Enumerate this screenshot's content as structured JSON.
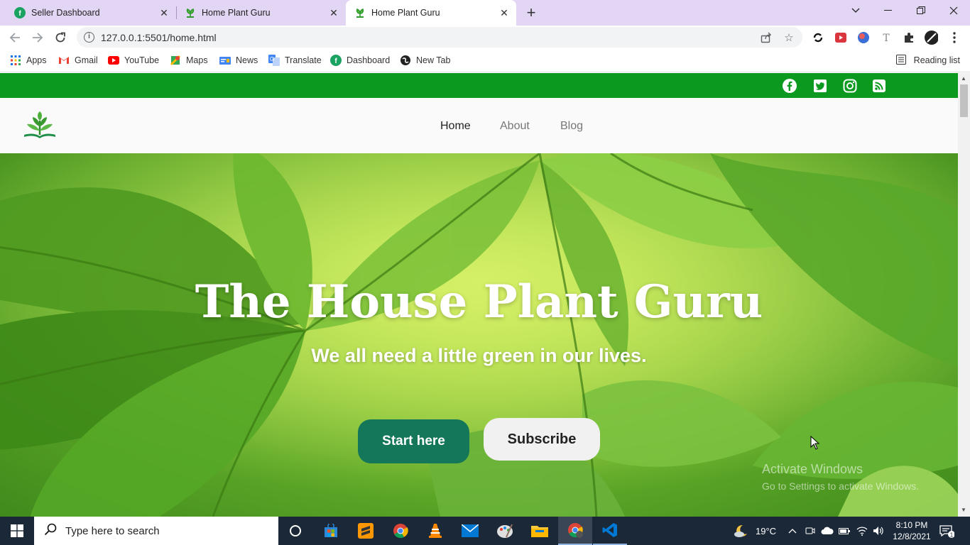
{
  "browser": {
    "tabs": [
      {
        "title": "Seller Dashboard",
        "icon": "dashboard-favicon"
      },
      {
        "title": "Home Plant Guru",
        "icon": "plant-favicon"
      },
      {
        "title": "Home Plant Guru",
        "icon": "plant-favicon",
        "active": true
      }
    ],
    "url": "127.0.0.1:5501/home.html",
    "bookmarks": [
      {
        "label": "Apps"
      },
      {
        "label": "Gmail"
      },
      {
        "label": "YouTube"
      },
      {
        "label": "Maps"
      },
      {
        "label": "News"
      },
      {
        "label": "Translate"
      },
      {
        "label": "Dashboard"
      },
      {
        "label": "New Tab"
      }
    ],
    "reading_list": "Reading list"
  },
  "site": {
    "social": [
      "facebook-icon",
      "twitter-icon",
      "instagram-icon",
      "rss-icon"
    ],
    "nav": [
      {
        "label": "Home",
        "current": true
      },
      {
        "label": "About"
      },
      {
        "label": "Blog"
      }
    ],
    "hero": {
      "title": "The House Plant Guru",
      "subtitle": "We all need a little green in our lives.",
      "start_label": "Start here",
      "subscribe_label": "Subscribe"
    },
    "watermark": {
      "line1": "Activate Windows",
      "line2": "Go to Settings to activate Windows."
    }
  },
  "taskbar": {
    "search_placeholder": "Type here to search",
    "weather": "19°C",
    "time": "8:10 PM",
    "date": "12/8/2021",
    "notification_count": "1"
  },
  "colors": {
    "tab_strip": "#e3d5f4",
    "site_green_bar": "#0b9a1f",
    "start_button": "#14775a",
    "taskbar": "#1b2838"
  }
}
